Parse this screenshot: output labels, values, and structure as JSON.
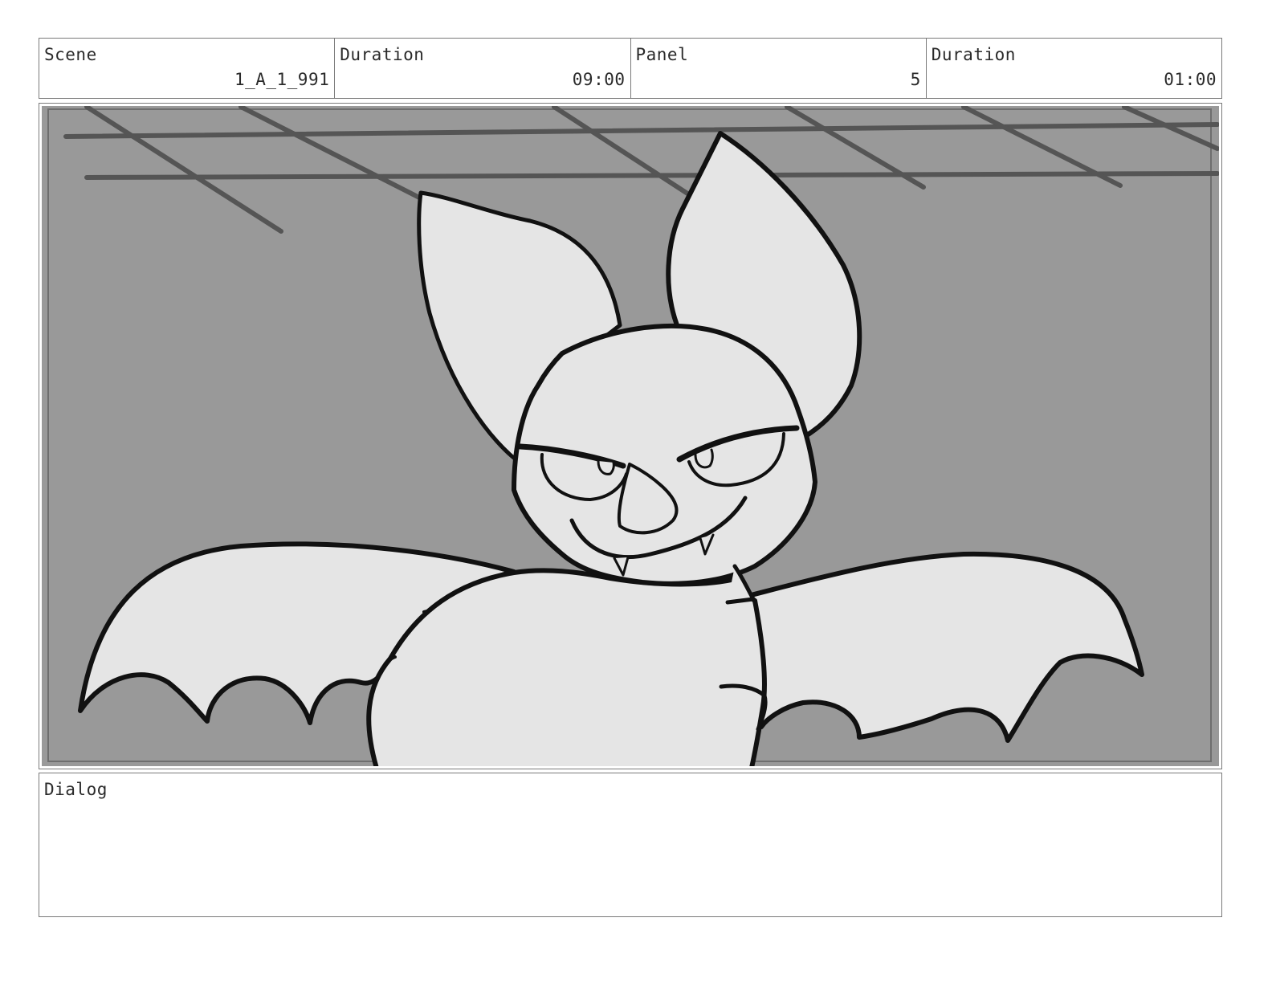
{
  "header": {
    "cells": [
      {
        "label": "Scene",
        "value": "1_A_1_991"
      },
      {
        "label": "Duration",
        "value": "09:00"
      },
      {
        "label": "Panel",
        "value": "5"
      },
      {
        "label": "Duration",
        "value": "01:00"
      }
    ]
  },
  "panel": {
    "drawing": "bat-character-icon",
    "colors": {
      "background": "#999999",
      "ceiling_lines": "#555555",
      "character_fill": "#e5e5e5",
      "outline": "#111111"
    }
  },
  "dialog": {
    "label": "Dialog",
    "text": ""
  }
}
